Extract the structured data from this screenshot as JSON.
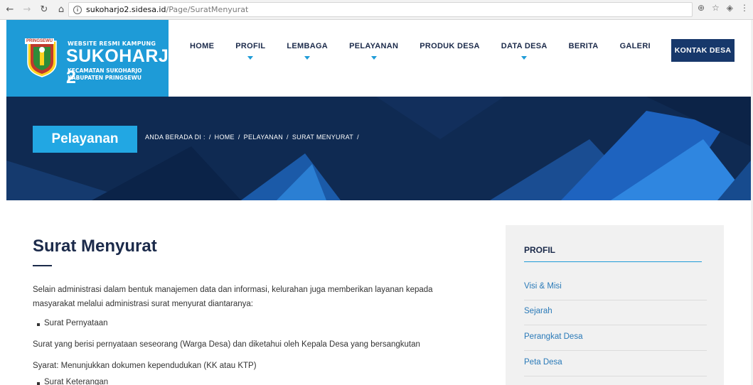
{
  "browser": {
    "url_host": "sukoharjo2.sidesa.id",
    "url_path": "/Page/SuratMenyurat"
  },
  "header": {
    "logo": {
      "tag": "PRINGSEWU",
      "line1": "WEBSITE RESMI KAMPUNG",
      "line2": "SUKOHARJO 2",
      "line3": "KECAMATAN SUKOHARJO",
      "line4": "KABUPATEN PRINGSEWU"
    },
    "menu": [
      {
        "label": "HOME",
        "has_dropdown": false
      },
      {
        "label": "PROFIL",
        "has_dropdown": true
      },
      {
        "label": "LEMBAGA",
        "has_dropdown": true
      },
      {
        "label": "PELAYANAN",
        "has_dropdown": true
      },
      {
        "label": "PRODUK DESA",
        "has_dropdown": false
      },
      {
        "label": "DATA DESA",
        "has_dropdown": true
      },
      {
        "label": "BERITA",
        "has_dropdown": false
      },
      {
        "label": "GALERI",
        "has_dropdown": false
      }
    ],
    "contact_button": "KONTAK DESA"
  },
  "banner": {
    "page_tag": "Pelayanan",
    "breadcrumb": [
      "ANDA BERADA DI :",
      "/",
      "HOME",
      "/",
      "PELAYANAN",
      "/",
      "SURAT MENYURAT",
      "/"
    ]
  },
  "content": {
    "title": "Surat Menyurat",
    "intro_line1": "Selain administrasi dalam bentuk manajemen data dan informasi, kelurahan juga memberikan layanan kepada",
    "intro_line2": "masyarakat melalui administrasi surat menyurat diantaranya:",
    "bullet1": "Surat Pernyataan",
    "desc1": "Surat yang berisi pernyataan seseorang (Warga Desa) dan diketahui oleh Kepala Desa yang bersangkutan",
    "req1": "Syarat: Menunjukkan dokumen kependudukan (KK atau KTP)",
    "bullet2": "Surat Keterangan"
  },
  "sidebar": {
    "title": "PROFIL",
    "links": [
      "Visi & Misi",
      "Sejarah",
      "Perangkat Desa",
      "Peta Desa"
    ]
  },
  "colors": {
    "brand_blue": "#1e9bd7",
    "navy": "#17386b",
    "banner_dark": "#0f2a52"
  }
}
